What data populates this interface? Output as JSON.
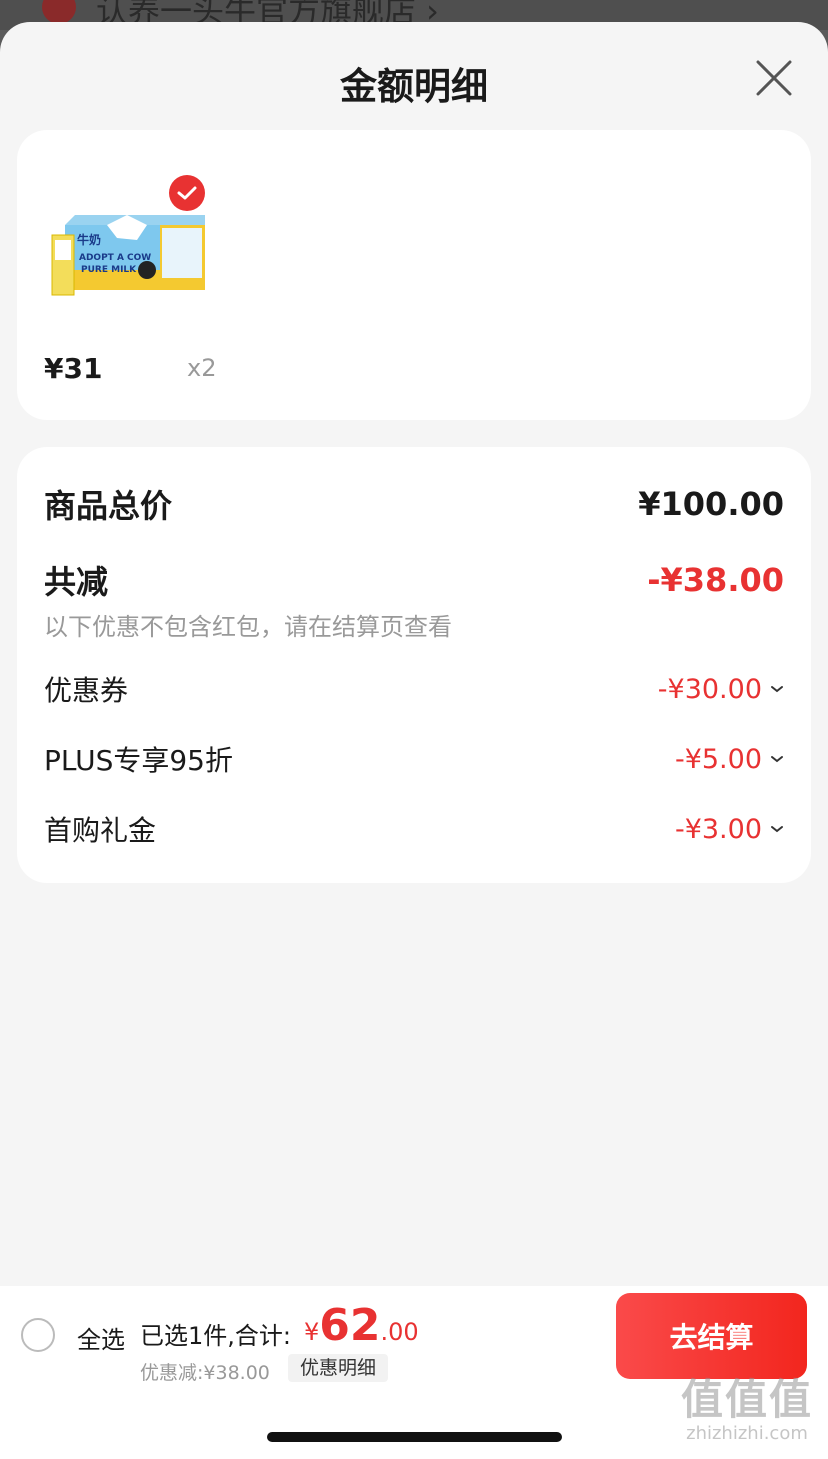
{
  "backdrop": {
    "store_name": "认养一头牛官方旗舰店 ›"
  },
  "sheet": {
    "title": "金额明细"
  },
  "product": {
    "price": "¥31",
    "quantity": "x2",
    "thumb_text_1": "牛奶",
    "thumb_text_2": "ADOPT A COW",
    "thumb_text_3": "PURE MILK"
  },
  "detail": {
    "total_label": "商品总价",
    "total_value": "¥100.00",
    "reduce_label": "共减",
    "reduce_value": "-¥38.00",
    "note": "以下优惠不包含红包，请在结算页查看",
    "items": [
      {
        "label": "优惠券",
        "value": "-¥30.00"
      },
      {
        "label": "PLUS专享95折",
        "value": "-¥5.00"
      },
      {
        "label": "首购礼金",
        "value": "-¥3.00"
      }
    ]
  },
  "bottom": {
    "select_all": "全选",
    "selected_text": "已选1件,合计:",
    "total_currency": "¥",
    "total_integer": "62",
    "total_decimal": ".00",
    "discount_text": "优惠减:¥38.00",
    "detail_link": "优惠明细",
    "checkout": "去结算"
  },
  "watermark": {
    "logo": "值值值",
    "site": "zhizhizhi.com"
  },
  "colors": {
    "accent": "#e83232",
    "background": "#f5f5f5",
    "card": "#ffffff"
  }
}
